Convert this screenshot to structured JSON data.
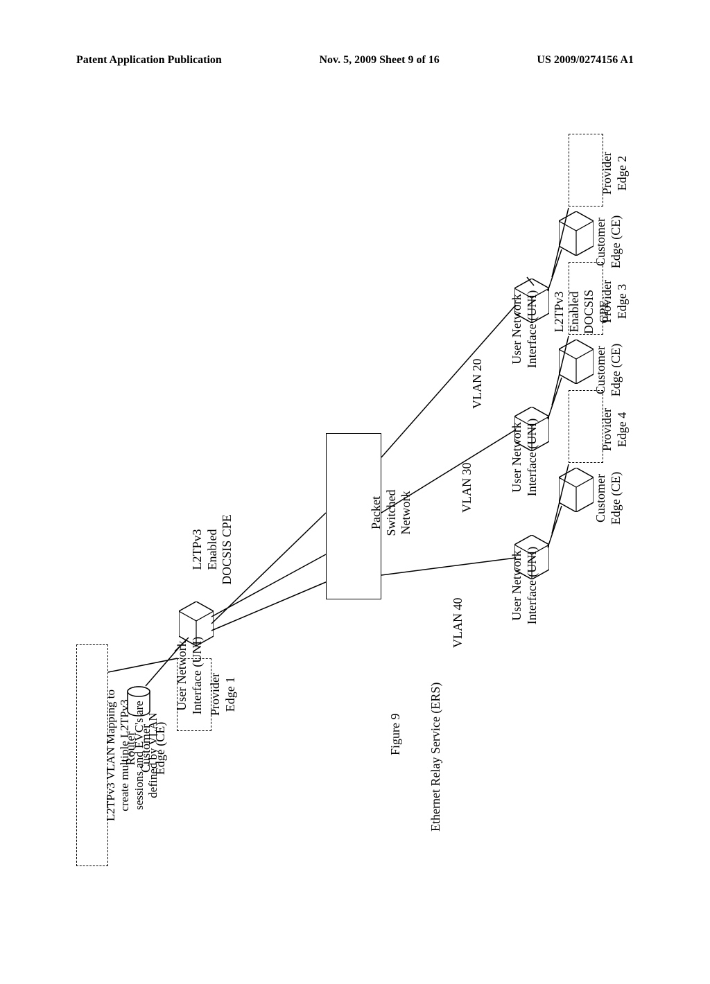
{
  "header": {
    "left": "Patent Application Publication",
    "center": "Nov. 5, 2009  Sheet 9 of 16",
    "right": "US 2009/0274156 A1"
  },
  "figure_label": "Figure 9",
  "service_label": "Ethernet Relay Service (ERS)",
  "psn_label": "Packet\nSwitched\nNetwork",
  "left_cpe": {
    "label": "L2TPv3\nEnabled\nDOCSIS CPE",
    "uni": "User Network\nInterface (UNI)",
    "ce_label": "Router\nCustomer\nEdge (CE)",
    "pe_label": "Provider\nEdge 1"
  },
  "note": "L2TPv3 VLAN Mapping to\ncreate multiple L2TPv3\nsessions and EVC's are\ndefined by VLAN",
  "vlans": [
    "VLAN 20",
    "VLAN 30",
    "VLAN 40"
  ],
  "right_cpe_label": "L2TPv3\nEnabled\nDOCSIS\nCPE",
  "right": [
    {
      "pe": "Provider\nEdge 2",
      "ce": "Customer\nEdge (CE)",
      "uni": "User Network\nInterface (UNI)"
    },
    {
      "pe": "Provider\nEdge 3",
      "ce": "Customer\nEdge (CE)",
      "uni": "User Network\nInterface (UNI)"
    },
    {
      "pe": "Provider\nEdge 4",
      "ce": "Customer\nEdge (CE)",
      "uni": "User Network\nInterface (UNI)"
    }
  ]
}
